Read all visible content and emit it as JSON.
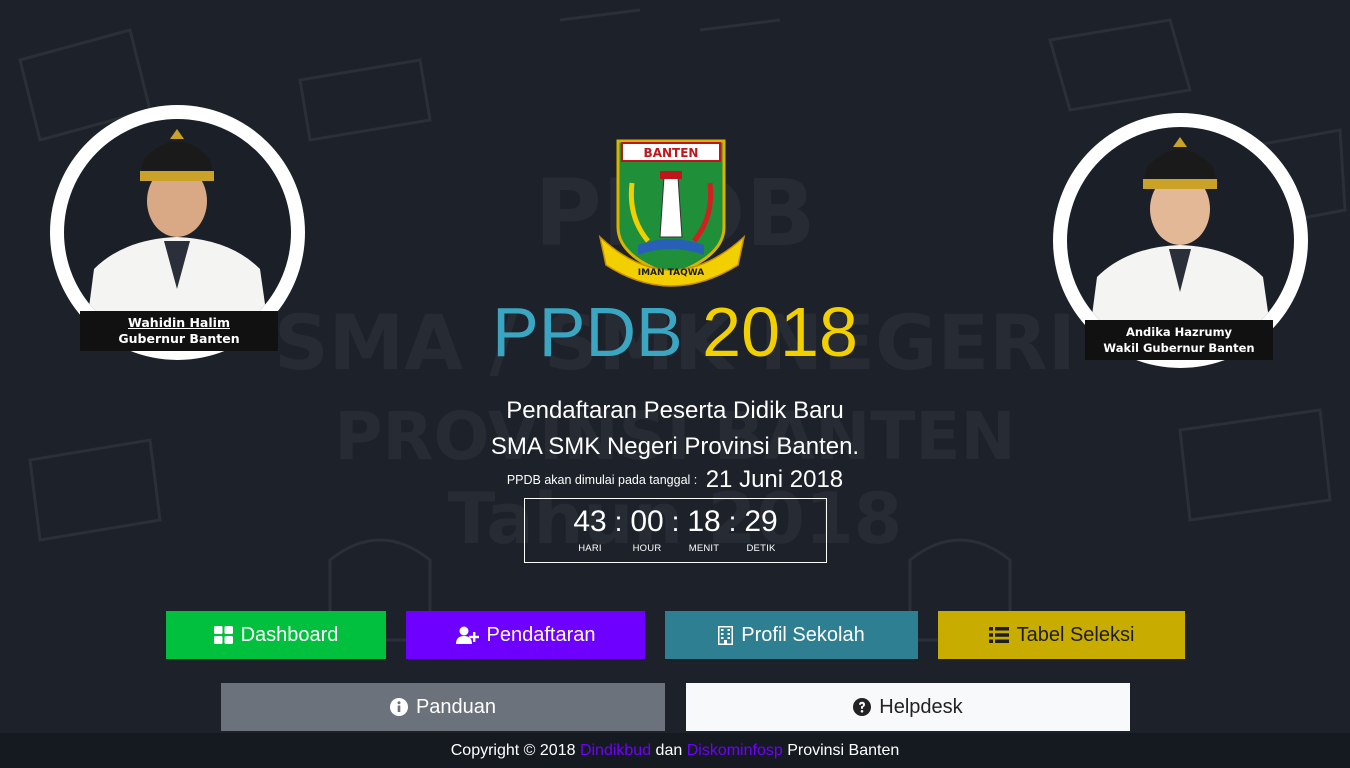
{
  "background_text": {
    "line1": "PPDB",
    "line2": "SMA / SMK NEGERI",
    "line3": "PROVINSI BANTEN",
    "line4": "Tahun 2018"
  },
  "left_official": {
    "name": "Wahidin Halim",
    "position": "Gubernur Banten"
  },
  "right_official": {
    "name": "Andika Hazrumy",
    "position": "Wakil Gubernur Banten"
  },
  "logo": {
    "top_text": "BANTEN",
    "bottom_text": "IMAN TAQWA"
  },
  "title": {
    "part1": "PPDB",
    "part2": "2018",
    "color1": "#3aa6c2",
    "color2": "#f2d000"
  },
  "subtitle": {
    "line1": "Pendaftaran Peserta Didik Baru",
    "line2": "SMA SMK Negeri Provinsi Banten."
  },
  "start": {
    "label": "PPDB akan dimulai pada tanggal :",
    "date": "21 Juni 2018"
  },
  "countdown": {
    "days": "43",
    "hours": "00",
    "minutes": "18",
    "seconds": "29",
    "separator": ":",
    "days_label": "HARI",
    "hours_label": "HOUR",
    "minutes_label": "MENIT",
    "seconds_label": "DETIK"
  },
  "buttons": {
    "dashboard": {
      "label": "Dashboard",
      "icon": "th-large-icon",
      "color": "#00c03d"
    },
    "pendaftaran": {
      "label": "Pendaftaran",
      "icon": "user-plus-icon",
      "color": "#6e00ff"
    },
    "profil": {
      "label": "Profil Sekolah",
      "icon": "building-icon",
      "color": "#2e7f91"
    },
    "tabel": {
      "label": "Tabel Seleksi",
      "icon": "list-icon",
      "color": "#c9ac00"
    },
    "panduan": {
      "label": "Panduan",
      "icon": "info-circle-icon",
      "color": "#6c727c"
    },
    "helpdesk": {
      "label": "Helpdesk",
      "icon": "question-circle-icon",
      "color": "#f8f9fa"
    }
  },
  "footer": {
    "prefix": "Copyright © 2018",
    "link1": "Dindikbud",
    "middle": "dan",
    "link2": "Diskominfosp",
    "suffix": "Provinsi Banten",
    "link_color": "#6e00ff"
  }
}
